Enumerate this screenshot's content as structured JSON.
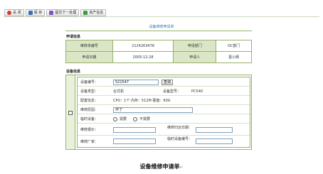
{
  "toolbar": {
    "close_label": "关 闭",
    "save_label": "保 存",
    "submit_label": "提交下一处理",
    "asset_label": "资产信息"
  },
  "form": {
    "title": "设备维修申请单"
  },
  "apply_info": {
    "section_title": "申请信息",
    "order_no_label": "维修单编号",
    "order_no": "2124263478",
    "dept_label": "申请部门",
    "dept": "OC部门",
    "date_label": "申请日期",
    "date": "2005-12-28",
    "applicant_label": "申请人",
    "applicant": "葛小辉"
  },
  "device_info": {
    "section_title": "设备信息",
    "code_label": "设备编号：",
    "code_value": "521547",
    "query_label": "查询",
    "type_label": "设备类型：",
    "type_value": "台式机",
    "model_label": "设备型号：",
    "model_value": "PC540",
    "config_label": "配置信息：",
    "config_value": "CPU：1个  内存：512M  硬盘：60G",
    "reason_label": "维修原因：",
    "reason_value": "坏了",
    "temp_label": "临时设备：",
    "radio_need": "需要",
    "radio_no_need": "不需要",
    "quote_label": "维修报价：",
    "return_date_label": "维修归还日期：",
    "vendor_label": "维修厂家：",
    "temp_code_label": "临时设备编号："
  },
  "caption": {
    "text": "设备维修申请单",
    "mark": "↵"
  }
}
